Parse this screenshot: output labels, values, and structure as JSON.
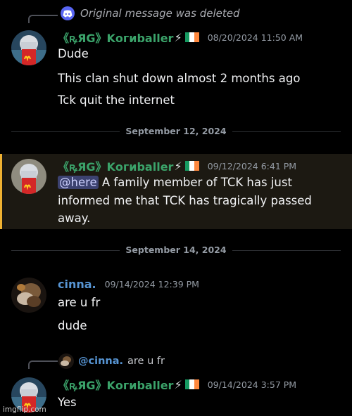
{
  "colors": {
    "background": "#000000",
    "username_green": "#3ba36a",
    "username_blue": "#5795d4",
    "mention_bg": "#3c4270",
    "highlight_border": "#f0b232",
    "discord_blurple": "#5865f2"
  },
  "reply_deleted": {
    "icon": "discord-logo-icon",
    "text": "Original message was deleted"
  },
  "message1": {
    "username": "《ꝶЯG》Kогиballer",
    "emoji_bolt": "⚡",
    "flag": "irish-flag-icon",
    "timestamp": "08/20/2024 11:50 AM",
    "lines": [
      "Dude",
      "This clan shut down almost 2 months ago",
      "Tck quit the internet"
    ]
  },
  "divider1": {
    "label": "September 12, 2024"
  },
  "message2": {
    "username": "《ꝶЯG》Kогиballer",
    "emoji_bolt": "⚡",
    "flag": "irish-flag-icon",
    "timestamp": "09/12/2024 6:41 PM",
    "mention": "@here",
    "line1_rest": " A family member of TCK has just",
    "line2": "informed me that TCK has tragically passed",
    "line3": "away."
  },
  "divider2": {
    "label": "September 14, 2024"
  },
  "message3": {
    "username": "cinna.",
    "timestamp": "09/14/2024 12:39 PM",
    "lines": [
      "are u fr",
      "dude"
    ]
  },
  "reply_to_cinna": {
    "mention": "@cinna.",
    "text": "are u fr"
  },
  "message4": {
    "username": "《ꝶЯG》Kогиballer",
    "emoji_bolt": "⚡",
    "flag": "irish-flag-icon",
    "timestamp": "09/14/2024 3:57 PM",
    "lines": [
      "Yes"
    ]
  },
  "watermark": {
    "text": "imgflip.com"
  }
}
